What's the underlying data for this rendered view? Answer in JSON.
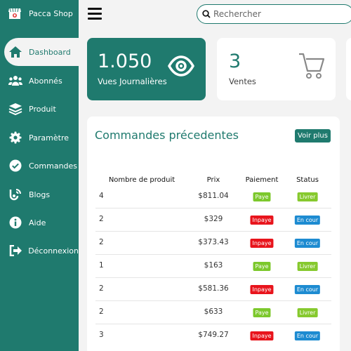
{
  "brand": {
    "name": "Pacca Shop",
    "icon": "shop-icon"
  },
  "nav": [
    {
      "label": "Dashboard",
      "icon": "home-icon",
      "active": true
    },
    {
      "label": "Abonnés",
      "icon": "users-icon"
    },
    {
      "label": "Produit",
      "icon": "layers-icon"
    },
    {
      "label": "Paramètre",
      "icon": "gear-icon"
    },
    {
      "label": "Commandes",
      "icon": "check-circle-icon"
    },
    {
      "label": "Blogs",
      "icon": "blog-icon"
    },
    {
      "label": "Aide",
      "icon": "info-icon"
    },
    {
      "label": "Déconnexion",
      "icon": "logout-icon"
    }
  ],
  "search": {
    "placeholder": "Rechercher",
    "value": ""
  },
  "cards": {
    "views": {
      "value": "1.050",
      "label": "Vues Journalières",
      "icon": "eye-icon"
    },
    "sales": {
      "value": "3",
      "label": "Ventes",
      "icon": "cart-icon"
    }
  },
  "orders": {
    "title": "Commandes précedentes",
    "see_more": "Voir plus",
    "columns": [
      "Nombre de produit",
      "Prix",
      "Paiement",
      "Status"
    ],
    "rows": [
      {
        "qty": "4",
        "price": "$811.04",
        "payment": "Paye",
        "status": "Livrer"
      },
      {
        "qty": "2",
        "price": "$329",
        "payment": "Inpaye",
        "status": "En cour"
      },
      {
        "qty": "2",
        "price": "$373.43",
        "payment": "Inpaye",
        "status": "En cour"
      },
      {
        "qty": "1",
        "price": "$163",
        "payment": "Paye",
        "status": "Livrer"
      },
      {
        "qty": "2",
        "price": "$581.36",
        "payment": "Inpaye",
        "status": "En cour"
      },
      {
        "qty": "2",
        "price": "$633",
        "payment": "Paye",
        "status": "Livrer"
      },
      {
        "qty": "3",
        "price": "$749.27",
        "payment": "Inpaye",
        "status": "En cour"
      }
    ]
  },
  "colors": {
    "primary": "#1f7a6e",
    "paye": "#7cc82c",
    "inpaye": "#e8141c",
    "livrer": "#86c92e",
    "en_cour": "#1d8bd1"
  }
}
